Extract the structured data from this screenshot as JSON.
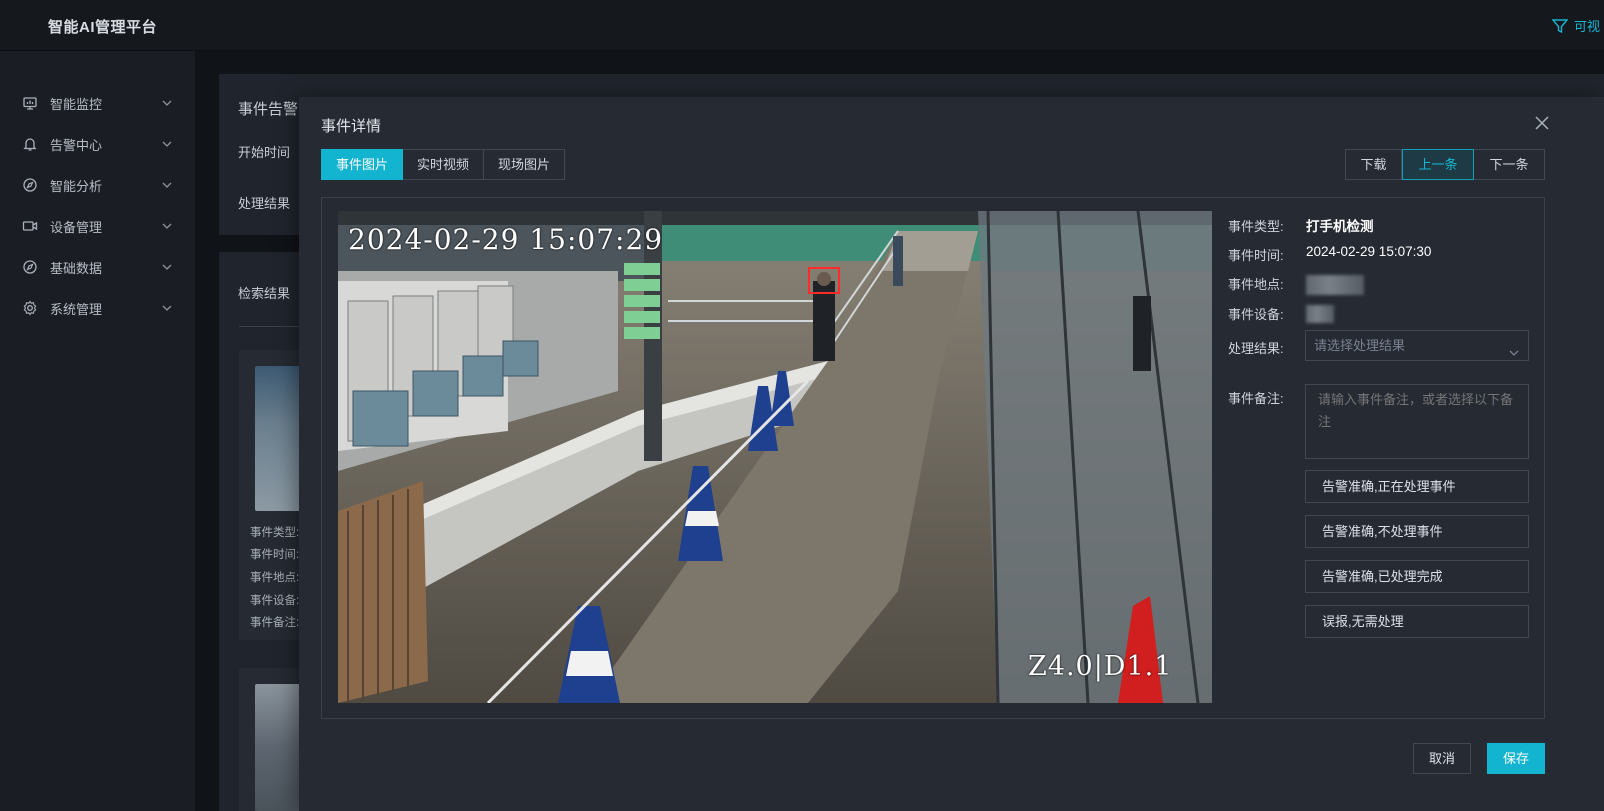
{
  "app": {
    "title": "智能AI管理平台",
    "top_right_label": "可视"
  },
  "sidebar": {
    "items": [
      {
        "label": "智能监控",
        "icon": "monitor-icon"
      },
      {
        "label": "告警中心",
        "icon": "bell-icon"
      },
      {
        "label": "智能分析",
        "icon": "compass-icon"
      },
      {
        "label": "设备管理",
        "icon": "camera-icon"
      },
      {
        "label": "基础数据",
        "icon": "compass-icon"
      },
      {
        "label": "系统管理",
        "icon": "gear-icon"
      }
    ]
  },
  "background": {
    "section_title": "事件告警",
    "start_time_label": "开始时间",
    "result_label": "处理结果",
    "search_results_label": "检索结果",
    "thumb_fields": [
      "事件类型:",
      "事件时间:",
      "事件地点:",
      "事件设备:",
      "事件备注:"
    ]
  },
  "modal": {
    "title": "事件详情",
    "tabs": [
      "事件图片",
      "实时视频",
      "现场图片"
    ],
    "nav": {
      "download": "下载",
      "prev": "上一条",
      "next": "下一条"
    },
    "camera": {
      "timestamp": "2024-02-29 15:07:29",
      "zoom": "Z4.0|D1.1"
    },
    "details": {
      "type_label": "事件类型:",
      "type_value": "打手机检测",
      "time_label": "事件时间:",
      "time_value": "2024-02-29 15:07:30",
      "location_label": "事件地点:",
      "device_label": "事件设备:",
      "result_label": "处理结果:",
      "result_placeholder": "请选择处理结果",
      "remark_label": "事件备注:",
      "remark_placeholder": "请输入事件备注，或者选择以下备注"
    },
    "quick_remarks": [
      "告警准确,正在处理事件",
      "告警准确,不处理事件",
      "告警准确,已处理完成",
      "误报,无需处理"
    ],
    "footer": {
      "cancel": "取消",
      "save": "保存"
    }
  },
  "colors": {
    "accent": "#12b4d0",
    "detect_box": "#ff2a2a"
  }
}
